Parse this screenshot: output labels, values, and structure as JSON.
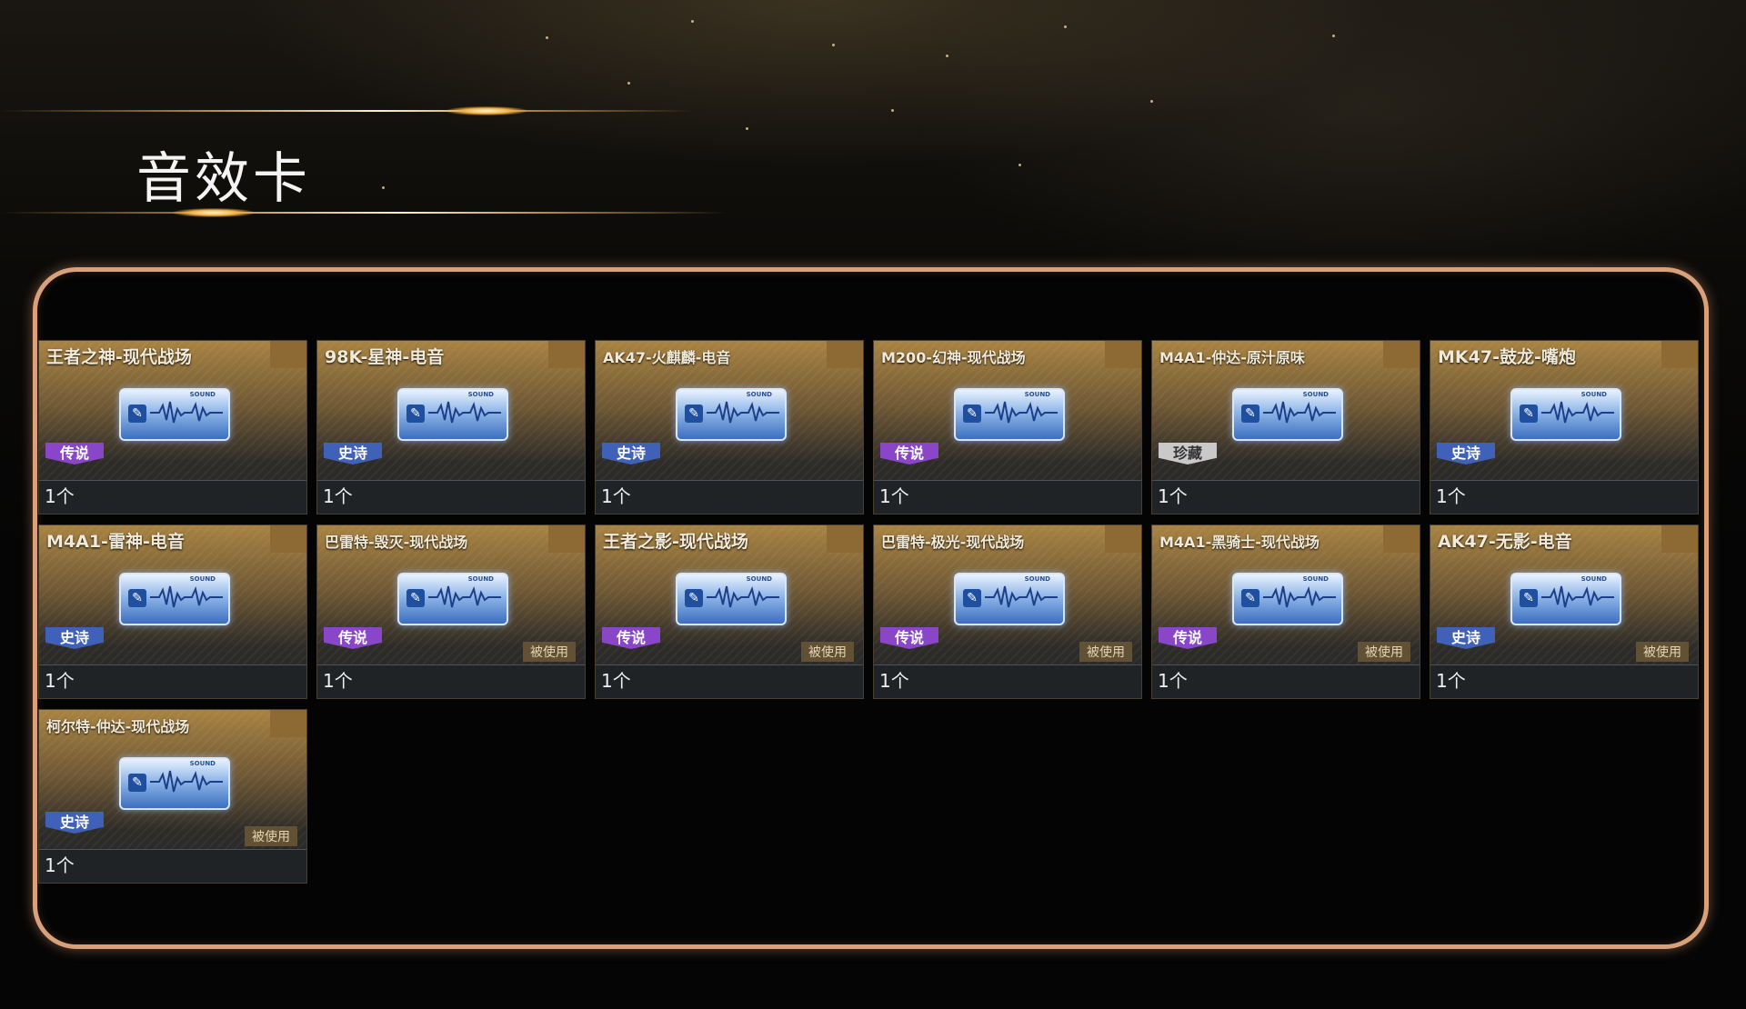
{
  "page": {
    "title": "音效卡"
  },
  "colors": {
    "frame_border": "#d9a07a",
    "rarity_legend": "#8a46c8",
    "rarity_epic": "#3f61b8",
    "rarity_collection": "#c9c9c9"
  },
  "cards": [
    {
      "name": "王者之神-现代战场",
      "rarity": "传说",
      "rarity_color": "purple",
      "count": "1个",
      "used": ""
    },
    {
      "name": "98K-星神-电音",
      "rarity": "史诗",
      "rarity_color": "blue",
      "count": "1个",
      "used": ""
    },
    {
      "name": "AK47-火麒麟-电音",
      "rarity": "史诗",
      "rarity_color": "blue",
      "count": "1个",
      "used": ""
    },
    {
      "name": "M200-幻神-现代战场",
      "rarity": "传说",
      "rarity_color": "purple",
      "count": "1个",
      "used": ""
    },
    {
      "name": "M4A1-仲达-原汁原味",
      "rarity": "珍藏",
      "rarity_color": "gray",
      "count": "1个",
      "used": ""
    },
    {
      "name": "MK47-鼓龙-嘴炮",
      "rarity": "史诗",
      "rarity_color": "blue",
      "count": "1个",
      "used": ""
    },
    {
      "name": "M4A1-雷神-电音",
      "rarity": "史诗",
      "rarity_color": "blue",
      "count": "1个",
      "used": ""
    },
    {
      "name": "巴雷特-毁灭-现代战场",
      "rarity": "传说",
      "rarity_color": "purple",
      "count": "1个",
      "used": "被使用"
    },
    {
      "name": "王者之影-现代战场",
      "rarity": "传说",
      "rarity_color": "purple",
      "count": "1个",
      "used": "被使用"
    },
    {
      "name": "巴雷特-极光-现代战场",
      "rarity": "传说",
      "rarity_color": "purple",
      "count": "1个",
      "used": "被使用"
    },
    {
      "name": "M4A1-黑骑士-现代战场",
      "rarity": "传说",
      "rarity_color": "purple",
      "count": "1个",
      "used": "被使用"
    },
    {
      "name": "AK47-无影-电音",
      "rarity": "史诗",
      "rarity_color": "blue",
      "count": "1个",
      "used": "被使用"
    },
    {
      "name": "柯尔特-仲达-现代战场",
      "rarity": "史诗",
      "rarity_color": "blue",
      "count": "1个",
      "used": "被使用"
    }
  ],
  "card_icon": {
    "label": "SOUND",
    "icon": "sound-wave-icon"
  }
}
